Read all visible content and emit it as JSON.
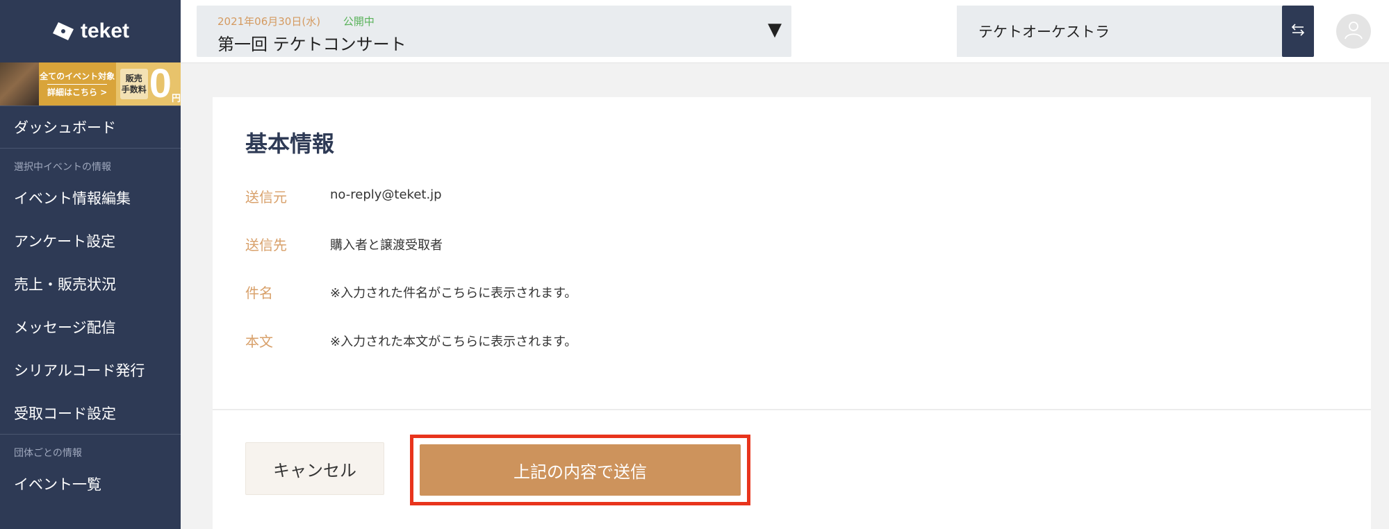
{
  "brand": {
    "name": "teket"
  },
  "promo": {
    "line1": "全てのイベント対象",
    "line2": "詳細はこちら >",
    "fee_label": "販売\n手数料",
    "zero": "0",
    "yen": "円"
  },
  "sidebar": {
    "dashboard": "ダッシュボード",
    "section_event": "選択中イベントの情報",
    "event_items": [
      "イベント情報編集",
      "アンケート設定",
      "売上・販売状況",
      "メッセージ配信",
      "シリアルコード発行",
      "受取コード設定"
    ],
    "section_org": "団体ごとの情報",
    "org_items": [
      "イベント一覧"
    ]
  },
  "header": {
    "event_date": "2021年06月30日(水)",
    "event_status": "公開中",
    "event_title": "第一回 テケトコンサート",
    "event_caret": "▼",
    "org_name": "テケトオーケストラ"
  },
  "card": {
    "title": "基本情報",
    "rows": [
      {
        "label": "送信元",
        "value": "no-reply@teket.jp"
      },
      {
        "label": "送信先",
        "value": "購入者と譲渡受取者"
      },
      {
        "label": "件名",
        "value": "※入力された件名がこちらに表示されます。"
      },
      {
        "label": "本文",
        "value": "※入力された本文がこちらに表示されます。"
      }
    ],
    "cancel_label": "キャンセル",
    "submit_label": "上記の内容で送信"
  },
  "colors": {
    "sidebar_bg": "#2e3a55",
    "accent": "#cd935c",
    "label": "#d8a06a",
    "status_green": "#59b25a",
    "highlight_red": "#e8341c"
  }
}
